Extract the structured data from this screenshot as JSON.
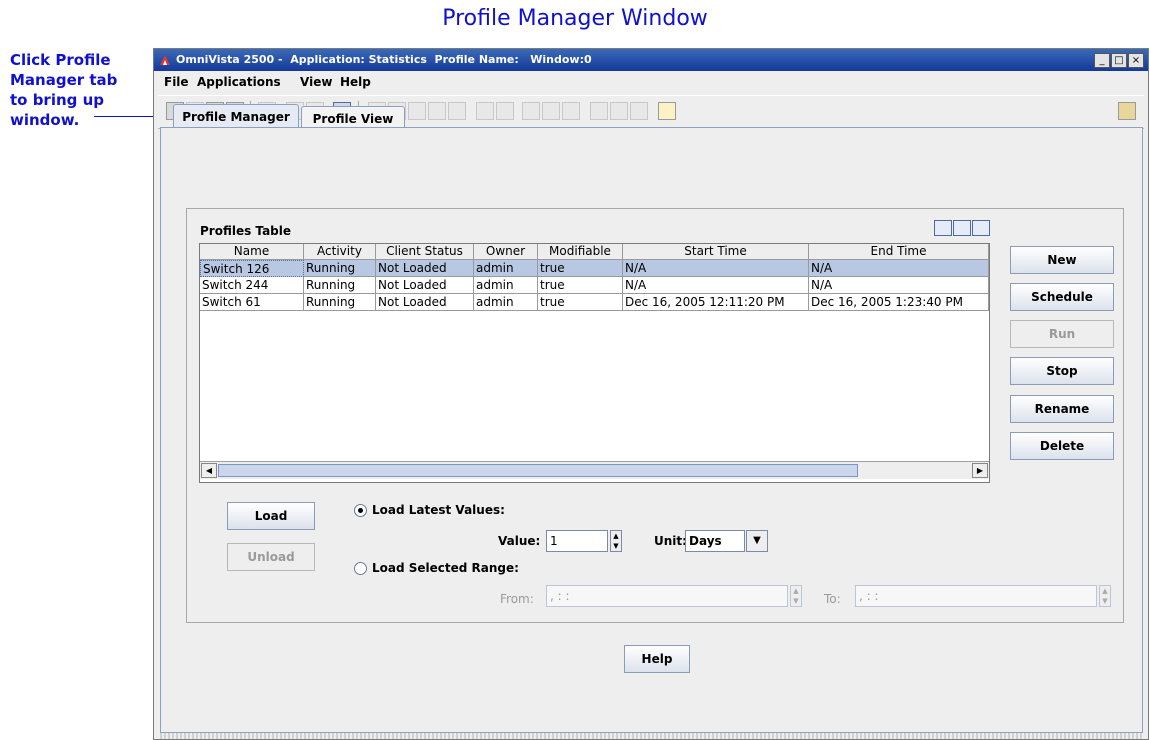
{
  "annotation": {
    "title": "Profile Manager Window",
    "note_lines": [
      "Click Profile",
      "Manager tab",
      "to bring up",
      "window."
    ]
  },
  "window": {
    "title": "OmniVista 2500 -  Application: Statistics  Profile Name:   Window:0",
    "controls": [
      "_",
      "□",
      "×"
    ]
  },
  "menu": [
    "File",
    "Applications",
    "View",
    "Help"
  ],
  "tabs": [
    {
      "label": "Profile Manager",
      "active": true
    },
    {
      "label": "Profile View",
      "active": false
    }
  ],
  "profiles_table": {
    "title": "Profiles Table",
    "columns": [
      "Name",
      "Activity",
      "Client Status",
      "Owner",
      "Modifiable",
      "Start Time",
      "End Time"
    ],
    "rows": [
      [
        "Switch 126",
        "Running",
        "Not Loaded",
        "admin",
        "true",
        "N/A",
        "N/A"
      ],
      [
        "Switch 244",
        "Running",
        "Not Loaded",
        "admin",
        "true",
        "N/A",
        "N/A"
      ],
      [
        "Switch 61",
        "Running",
        "Not Loaded",
        "admin",
        "true",
        "Dec 16, 2005 12:11:20 PM",
        "Dec 16, 2005 1:23:40 PM"
      ]
    ],
    "selected_row": 0
  },
  "side_buttons": [
    {
      "label": "New",
      "enabled": true
    },
    {
      "label": "Schedule",
      "enabled": true
    },
    {
      "label": "Run",
      "enabled": false
    },
    {
      "label": "Stop",
      "enabled": true
    },
    {
      "label": "Rename",
      "enabled": true
    },
    {
      "label": "Delete",
      "enabled": true
    }
  ],
  "load": {
    "load_label": "Load",
    "unload_label": "Unload",
    "latest_label": "Load Latest Values:",
    "value_label": "Value:",
    "value": "1",
    "unit_label": "Unit:",
    "unit": "Days",
    "range_label": "Load Selected Range:",
    "from_label": "From:",
    "from_value": "  ,       : :",
    "to_label": "To:",
    "to_value": "  ,       : :"
  },
  "help_label": "Help",
  "colors": {
    "accent": "#1010d0",
    "title_bar": "#15389a",
    "selection": "#b8c8e2"
  }
}
